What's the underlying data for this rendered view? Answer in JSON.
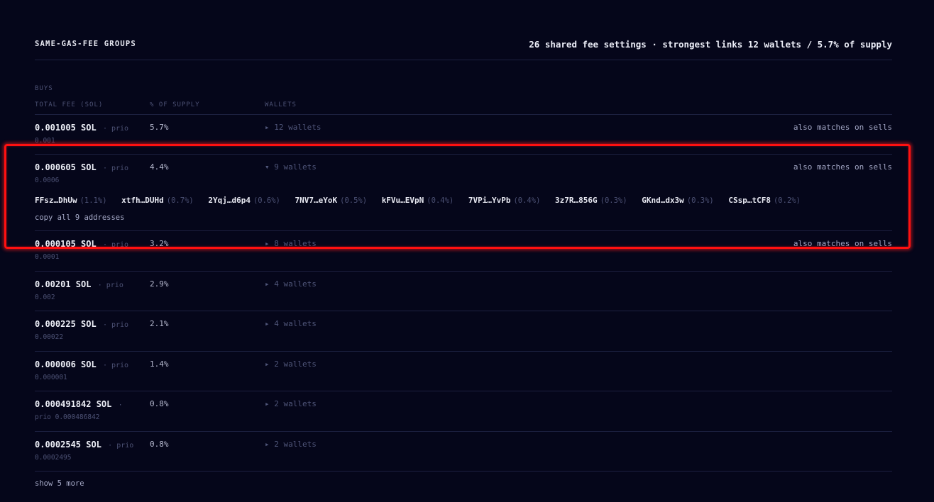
{
  "header": {
    "title": "SAME-GAS-FEE GROUPS",
    "summary": "26 shared fee settings · strongest links 12 wallets / 5.7% of supply"
  },
  "table": {
    "section": "BUYS",
    "columns": [
      "TOTAL FEE (SOL)",
      "% OF SUPPLY",
      "WALLETS"
    ],
    "rows": [
      {
        "fee": "0.001005 SOL",
        "prio_tag": "· prio",
        "prio_value": "0.001",
        "pct": "5.7%",
        "wallets": "▸ 12 wallets",
        "match": "also matches on sells"
      },
      {
        "fee": "0.000605 SOL",
        "prio_tag": "· prio",
        "prio_value": "0.0006",
        "pct": "4.4%",
        "wallets": "▾ 9 wallets",
        "match": "also matches on sells"
      },
      {
        "fee": "0.000105 SOL",
        "prio_tag": "· prio",
        "prio_value": "0.0001",
        "pct": "3.2%",
        "wallets": "▸ 8 wallets",
        "match": "also matches on sells"
      },
      {
        "fee": "0.00201 SOL",
        "prio_tag": "· prio",
        "prio_value": "0.002",
        "pct": "2.9%",
        "wallets": "▸ 4 wallets",
        "match": ""
      },
      {
        "fee": "0.000225 SOL",
        "prio_tag": "· prio",
        "prio_value": "0.00022",
        "pct": "2.1%",
        "wallets": "▸ 4 wallets",
        "match": ""
      },
      {
        "fee": "0.000006 SOL",
        "prio_tag": "· prio",
        "prio_value": "0.000001",
        "pct": "1.4%",
        "wallets": "▸ 2 wallets",
        "match": ""
      },
      {
        "fee": "0.000491842 SOL",
        "prio_tag": "·",
        "prio_value": "prio 0.000486842",
        "pct": "0.8%",
        "wallets": "▸ 2 wallets",
        "match": ""
      },
      {
        "fee": "0.0002545 SOL",
        "prio_tag": "· prio",
        "prio_value": "0.0002495",
        "pct": "0.8%",
        "wallets": "▸ 2 wallets",
        "match": ""
      }
    ],
    "expanded": {
      "addresses": [
        {
          "addr": "FFsz…DhUw",
          "pct": "(1.1%)"
        },
        {
          "addr": "xtfh…DUHd",
          "pct": "(0.7%)"
        },
        {
          "addr": "2Yqj…d6p4",
          "pct": "(0.6%)"
        },
        {
          "addr": "7NV7…eYoK",
          "pct": "(0.5%)"
        },
        {
          "addr": "kFVu…EVpN",
          "pct": "(0.4%)"
        },
        {
          "addr": "7VPi…YvPb",
          "pct": "(0.4%)"
        },
        {
          "addr": "3z7R…856G",
          "pct": "(0.3%)"
        },
        {
          "addr": "GKnd…dx3w",
          "pct": "(0.3%)"
        },
        {
          "addr": "CSsp…tCF8",
          "pct": "(0.2%)"
        }
      ],
      "copy_label": "copy all 9 addresses"
    },
    "show_more": "show 5 more"
  },
  "colors": {
    "background": "#05061a",
    "highlight": "#ff1010",
    "muted": "#4c5174"
  }
}
